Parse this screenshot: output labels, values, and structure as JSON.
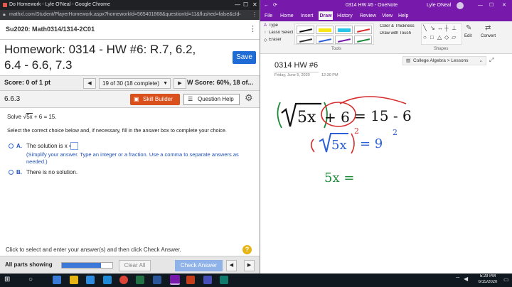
{
  "chrome": {
    "tab_title": "Do Homework - Lyle O'Neal - Google Chrome",
    "url": "mathxl.com/Student/PlayerHomework.aspx?homeworkId=565401868&questionId=11&flushed=false&cId=601..."
  },
  "course": {
    "title": "Su2020: Math0314/1314-2C01"
  },
  "homework": {
    "title_line1": "Homework: 0314 - HW #6: R.7, 6.2,",
    "title_line2": "6.4 - 6.6, 7.3",
    "save_label": "Save"
  },
  "scorebar": {
    "score": "Score: 0 of 1 pt",
    "question_select": "19 of 30 (18 complete)",
    "hw_score": "W Score: 60%, 18 of..."
  },
  "question": {
    "number": "6.6.3",
    "skill_builder": "Skill Builder",
    "question_help": "Question Help",
    "prompt_prefix": "Solve",
    "radicand": "5x",
    "prompt_suffix": "+ 6 = 15.",
    "instruction": "Select the correct choice below and, if necessary, fill in the answer box to complete your choice.",
    "choice_a_letter": "A.",
    "choice_a_text": "The solution is x =",
    "choice_a_note": "(Simplify your answer. Type an integer or a fraction. Use a comma to separate answers as needed.)",
    "choice_b_letter": "B.",
    "choice_b_text": "There is no solution."
  },
  "bottom": {
    "note": "Click to select and enter your answer(s) and then click Check Answer.",
    "help_glyph": "?",
    "parts": "All parts showing",
    "clear_all": "Clear All",
    "check_answer": "Check Answer",
    "progress": 0.78
  },
  "onenote": {
    "title": "0314 HW #6 - OneNote",
    "user": "Lyle ONeal",
    "tabs": [
      "File",
      "Home",
      "Insert",
      "Draw",
      "History",
      "Review",
      "View",
      "Help"
    ],
    "active_tab": "Draw",
    "tools": {
      "type": "Type",
      "lasso": "Lasso Select",
      "eraser": "Eraser",
      "color_thickness": "Color & Thickness",
      "draw_touch": "Draw with Touch",
      "group_tools": "Tools",
      "group_shapes": "Shapes",
      "edit": "Edit",
      "convert": "Convert"
    },
    "notebook": "College Algebra > Lessons",
    "page_title": "0314 HW #6",
    "page_date": "Friday, June 5, 2020",
    "page_time": "12:30 PM"
  },
  "ink": {
    "row1_radical": "5x",
    "row1_plus": "+ 6",
    "row1_rhs": "= 15 - 6",
    "row2_radical": "5x",
    "row2_exp": "2",
    "row2_rhs": "= 9",
    "row2_rhs_exp": "2",
    "row3": "5x ="
  },
  "taskbar": {
    "time": "5:29 PM",
    "date": "6/15/2020"
  },
  "colors": {
    "accent_blue": "#1f6bd6",
    "skill_orange": "#d9501c",
    "onenote_purple": "#7719aa",
    "ink_black": "#111111",
    "ink_red": "#d62c2c",
    "ink_blue": "#2a5fd6",
    "ink_green": "#1b8b3a"
  }
}
